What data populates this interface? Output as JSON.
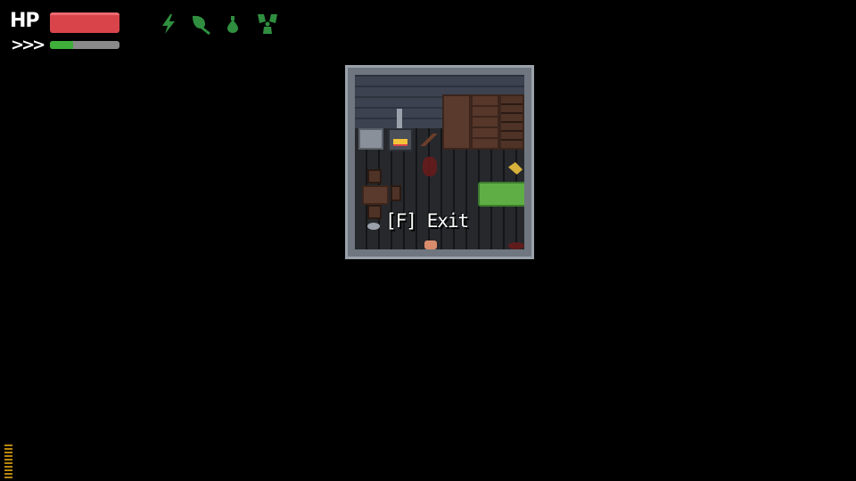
{
  "hud": {
    "hp_label": "HP",
    "stamina_label": ">>>",
    "hp_fraction": 1.0,
    "stamina_fraction": 0.33,
    "hp_color": "#d9444b",
    "stamina_color": "#3fae3a",
    "status_icons": [
      "lightning-icon",
      "leaf-icon",
      "drop-icon",
      "radiation-icon"
    ],
    "status_icon_color": "#2f8f3f"
  },
  "scene": {
    "interaction_prompt": "[F] Exit"
  }
}
